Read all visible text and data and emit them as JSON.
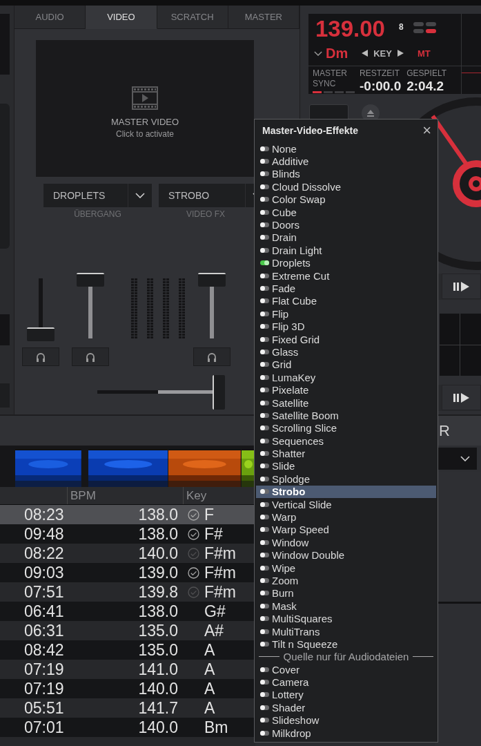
{
  "mixer": {
    "tabs": [
      {
        "label": "AUDIO",
        "selected": false
      },
      {
        "label": "VIDEO",
        "selected": true
      },
      {
        "label": "SCRATCH",
        "selected": false
      },
      {
        "label": "MASTER",
        "selected": false
      }
    ],
    "video_preview": {
      "title": "MASTER VIDEO",
      "subtitle": "Click to activate"
    },
    "selectors": [
      {
        "value": "DROPLETS",
        "label": "ÜBERGANG"
      },
      {
        "value": "STROBO",
        "label": "VIDEO FX"
      }
    ],
    "channel_faders": [
      {
        "level": 0.05
      },
      {
        "level": 1
      },
      {
        "level": 1
      }
    ],
    "crossfader": {
      "level": 1
    }
  },
  "deck": {
    "bpm": "139.00",
    "beats": "8",
    "key": "Dm",
    "key_label": "KEY",
    "mt": "MT",
    "sync_label": "MASTER SYNC",
    "sync_indicator": [
      {
        "on": true
      },
      {
        "on": false
      },
      {
        "on": false
      },
      {
        "on": false
      }
    ],
    "remaining_label": "RESTZEIT",
    "remaining": "-0:00.0",
    "elapsed_label": "GESPIELT",
    "elapsed": "2:04.2"
  },
  "side_panel": {
    "header_fragment": "R"
  },
  "browser": {
    "thumbnails": [
      {
        "kind": "picture"
      },
      {
        "kind": "picture"
      },
      {
        "kind": "picture"
      },
      {
        "kind": "picture"
      }
    ],
    "columns": [
      "BPM",
      "Key"
    ],
    "rows": [
      {
        "time": "08:23",
        "bpm": "138.0",
        "key": "F",
        "verified": true,
        "dim": false,
        "selected": true
      },
      {
        "time": "09:48",
        "bpm": "138.0",
        "key": "F#",
        "verified": true,
        "dim": false,
        "selected": false
      },
      {
        "time": "08:22",
        "bpm": "140.0",
        "key": "F#m",
        "verified": true,
        "dim": true,
        "selected": false
      },
      {
        "time": "09:03",
        "bpm": "139.0",
        "key": "F#m",
        "verified": true,
        "dim": false,
        "selected": false
      },
      {
        "time": "07:51",
        "bpm": "139.8",
        "key": "F#m",
        "verified": true,
        "dim": true,
        "selected": false
      },
      {
        "time": "06:41",
        "bpm": "138.0",
        "key": "G#",
        "verified": false,
        "selected": false
      },
      {
        "time": "06:31",
        "bpm": "135.0",
        "key": "A#",
        "verified": false,
        "selected": false
      },
      {
        "time": "08:42",
        "bpm": "135.0",
        "key": "A",
        "verified": false,
        "selected": false
      },
      {
        "time": "07:19",
        "bpm": "141.0",
        "key": "A",
        "verified": false,
        "selected": false
      },
      {
        "time": "07:19",
        "bpm": "140.0",
        "key": "A",
        "verified": false,
        "selected": false
      },
      {
        "time": "05:51",
        "bpm": "141.7",
        "key": "A",
        "verified": false,
        "selected": false
      },
      {
        "time": "07:01",
        "bpm": "140.0",
        "key": "Bm",
        "verified": false,
        "selected": false
      }
    ]
  },
  "effects_popup": {
    "title": "Master-Video-Effekte",
    "close": "×",
    "items": [
      {
        "kind": "effect",
        "label": "None",
        "on": false,
        "selected": false
      },
      {
        "kind": "effect",
        "label": "Additive",
        "on": false,
        "selected": false
      },
      {
        "kind": "effect",
        "label": "Blinds",
        "on": false,
        "selected": false
      },
      {
        "kind": "effect",
        "label": "Cloud Dissolve",
        "on": false,
        "selected": false
      },
      {
        "kind": "effect",
        "label": "Color Swap",
        "on": false,
        "selected": false
      },
      {
        "kind": "effect",
        "label": "Cube",
        "on": false,
        "selected": false
      },
      {
        "kind": "effect",
        "label": "Doors",
        "on": false,
        "selected": false
      },
      {
        "kind": "effect",
        "label": "Drain",
        "on": false,
        "selected": false
      },
      {
        "kind": "effect",
        "label": "Drain Light",
        "on": false,
        "selected": false
      },
      {
        "kind": "effect",
        "label": "Droplets",
        "on": true,
        "selected": false
      },
      {
        "kind": "effect",
        "label": "Extreme Cut",
        "on": false,
        "selected": false
      },
      {
        "kind": "effect",
        "label": "Fade",
        "on": false,
        "selected": false
      },
      {
        "kind": "effect",
        "label": "Flat Cube",
        "on": false,
        "selected": false
      },
      {
        "kind": "effect",
        "label": "Flip",
        "on": false,
        "selected": false
      },
      {
        "kind": "effect",
        "label": "Flip 3D",
        "on": false,
        "selected": false
      },
      {
        "kind": "effect",
        "label": "Fixed Grid",
        "on": false,
        "selected": false
      },
      {
        "kind": "effect",
        "label": "Glass",
        "on": false,
        "selected": false
      },
      {
        "kind": "effect",
        "label": "Grid",
        "on": false,
        "selected": false
      },
      {
        "kind": "effect",
        "label": "LumaKey",
        "on": false,
        "selected": false
      },
      {
        "kind": "effect",
        "label": "Pixelate",
        "on": false,
        "selected": false
      },
      {
        "kind": "effect",
        "label": "Satellite",
        "on": false,
        "selected": false
      },
      {
        "kind": "effect",
        "label": "Satellite Boom",
        "on": false,
        "selected": false
      },
      {
        "kind": "effect",
        "label": "Scrolling Slice",
        "on": false,
        "selected": false
      },
      {
        "kind": "effect",
        "label": "Sequences",
        "on": false,
        "selected": false
      },
      {
        "kind": "effect",
        "label": "Shatter",
        "on": false,
        "selected": false
      },
      {
        "kind": "effect",
        "label": "Slide",
        "on": false,
        "selected": false
      },
      {
        "kind": "effect",
        "label": "Splodge",
        "on": false,
        "selected": false
      },
      {
        "kind": "effect",
        "label": "Strobo",
        "on": false,
        "selected": true
      },
      {
        "kind": "effect",
        "label": "Vertical Slide",
        "on": false,
        "selected": false
      },
      {
        "kind": "effect",
        "label": "Warp",
        "on": false,
        "selected": false
      },
      {
        "kind": "effect",
        "label": "Warp Speed",
        "on": false,
        "selected": false
      },
      {
        "kind": "effect",
        "label": "Window",
        "on": false,
        "selected": false
      },
      {
        "kind": "effect",
        "label": "Window Double",
        "on": false,
        "selected": false
      },
      {
        "kind": "effect",
        "label": "Wipe",
        "on": false,
        "selected": false
      },
      {
        "kind": "effect",
        "label": "Zoom",
        "on": false,
        "selected": false
      },
      {
        "kind": "effect",
        "label": "Burn",
        "on": false,
        "selected": false
      },
      {
        "kind": "effect",
        "label": "Mask",
        "on": false,
        "selected": false
      },
      {
        "kind": "effect",
        "label": "MultiSquares",
        "on": false,
        "selected": false
      },
      {
        "kind": "effect",
        "label": "MultiTrans",
        "on": false,
        "selected": false
      },
      {
        "kind": "effect",
        "label": "Tilt n Squeeze",
        "on": false,
        "selected": false
      },
      {
        "kind": "separator",
        "label": "Quelle nur für Audiodateien"
      },
      {
        "kind": "effect",
        "label": "Cover",
        "on": false,
        "selected": false
      },
      {
        "kind": "effect",
        "label": "Camera",
        "on": false,
        "selected": false
      },
      {
        "kind": "effect",
        "label": "Lottery",
        "on": false,
        "selected": false
      },
      {
        "kind": "effect",
        "label": "Shader",
        "on": false,
        "selected": false
      },
      {
        "kind": "effect",
        "label": "Slideshow",
        "on": false,
        "selected": false
      },
      {
        "kind": "effect",
        "label": "Milkdrop",
        "on": false,
        "selected": false
      }
    ]
  }
}
